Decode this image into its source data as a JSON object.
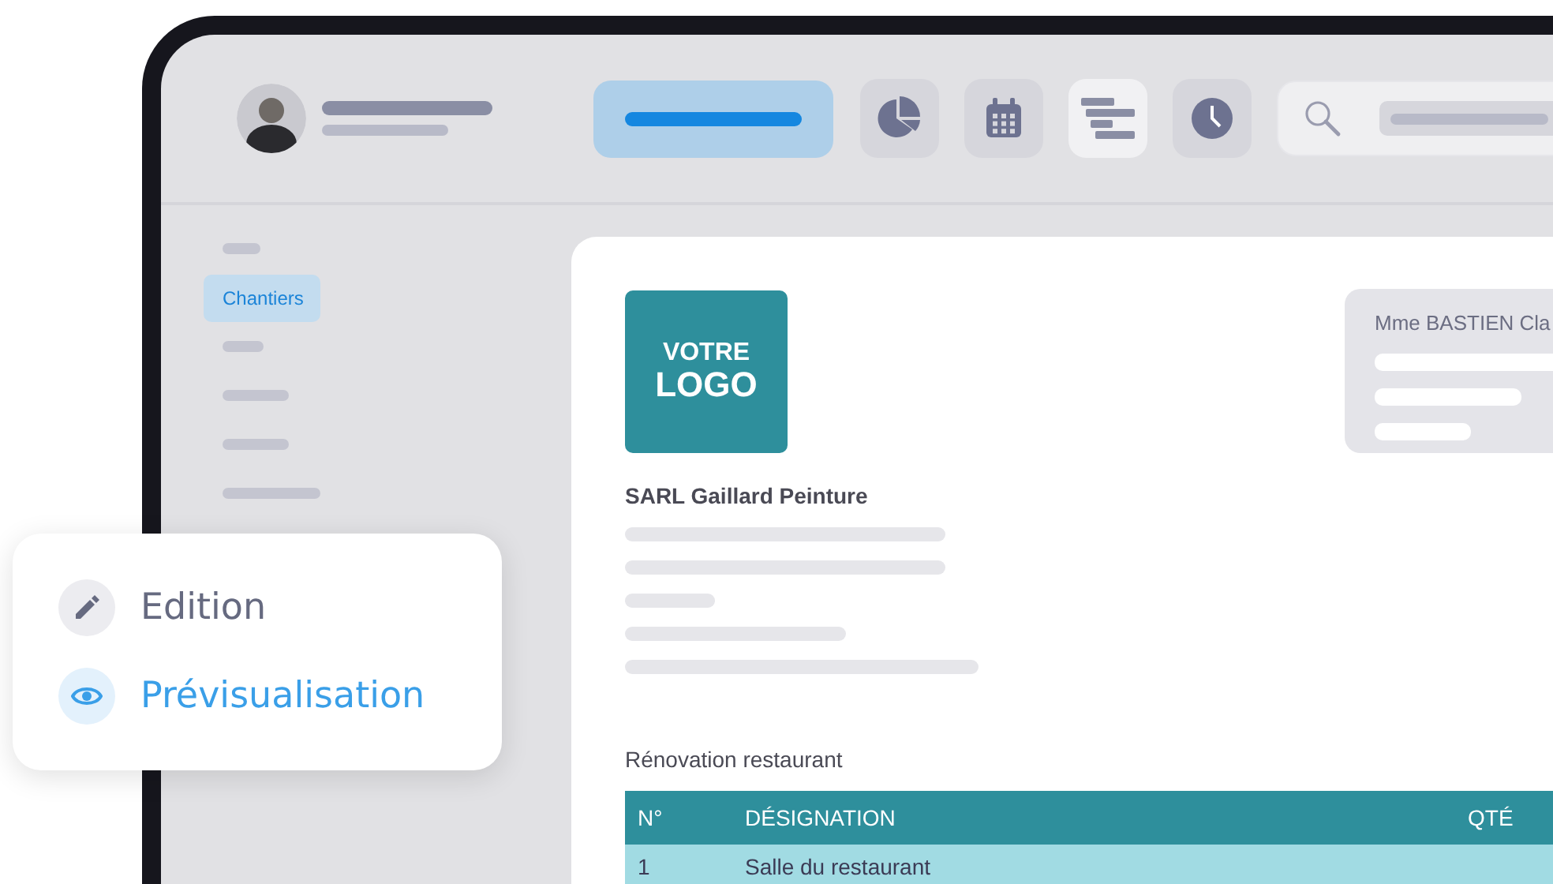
{
  "header": {
    "nav": [
      {
        "kind": "pill"
      },
      {
        "kind": "pie",
        "selected": false
      },
      {
        "kind": "calendar",
        "selected": false
      },
      {
        "kind": "gantt",
        "selected": true
      },
      {
        "kind": "clock",
        "selected": false
      }
    ]
  },
  "sidebar": {
    "items": [
      {
        "kind": "placeholder"
      },
      {
        "kind": "link",
        "label": "Chantiers",
        "selected": true
      },
      {
        "kind": "placeholder"
      },
      {
        "kind": "placeholder"
      },
      {
        "kind": "placeholder"
      },
      {
        "kind": "placeholder"
      }
    ]
  },
  "document": {
    "logo": [
      "VOTRE",
      "LOGO"
    ],
    "client": "Mme BASTIEN Cla",
    "company": "SARL Gaillard Peinture",
    "project": "Rénovation restaurant",
    "table": {
      "columns": [
        "N°",
        "DÉSIGNATION",
        "QTÉ"
      ],
      "rows": [
        {
          "cells": [
            "1",
            "Salle du restaurant"
          ]
        }
      ]
    }
  },
  "modes": [
    {
      "kind": "edit",
      "label": "Edition",
      "selected": false
    },
    {
      "kind": "preview",
      "label": "Prévisualisation",
      "selected": true
    }
  ]
}
